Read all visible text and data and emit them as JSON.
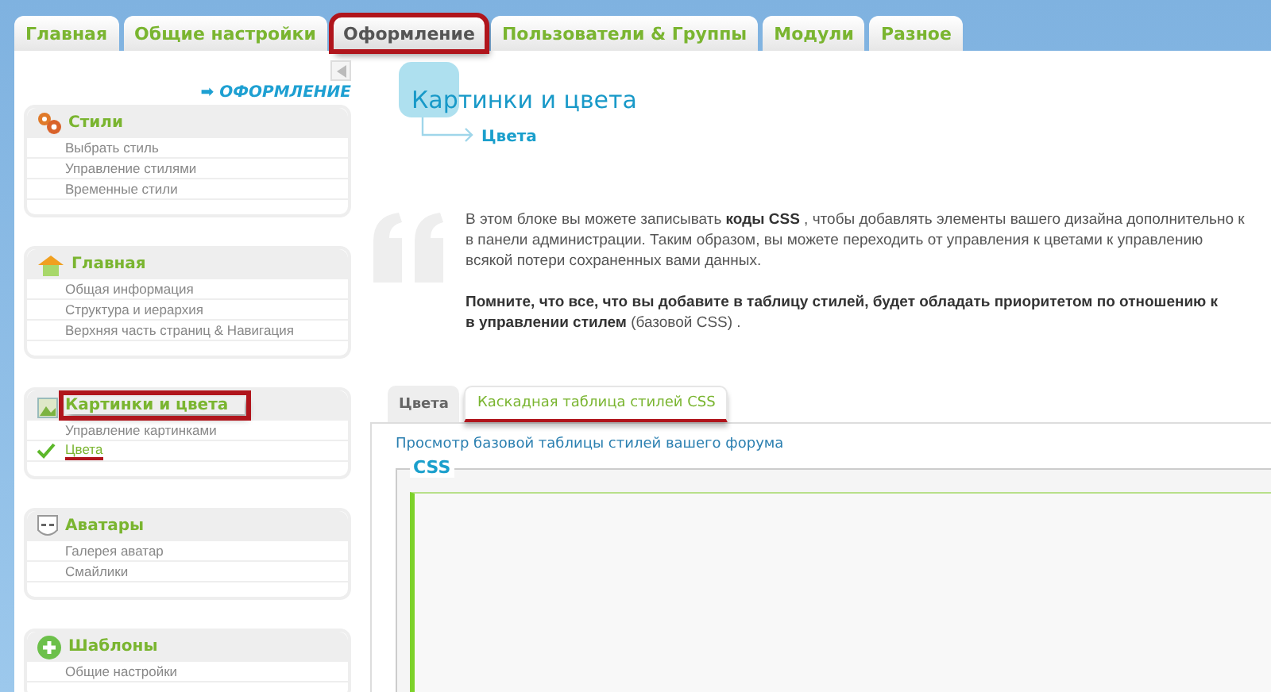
{
  "tabs": [
    {
      "label": "Главная",
      "selected": false,
      "highlighted": false
    },
    {
      "label": "Общие настройки",
      "selected": false,
      "highlighted": false
    },
    {
      "label": "Оформление",
      "selected": true,
      "highlighted": true
    },
    {
      "label": "Пользователи & Группы",
      "selected": false,
      "highlighted": false
    },
    {
      "label": "Модули",
      "selected": false,
      "highlighted": false
    },
    {
      "label": "Разное",
      "selected": false,
      "highlighted": false
    }
  ],
  "sidebar": {
    "section_title": "➡ ОФОРМЛЕНИЕ",
    "groups": [
      {
        "kind": "palette",
        "title": "Стили",
        "highlighted": false,
        "items": [
          {
            "label": "Выбрать стиль",
            "selected": false,
            "highlighted": false
          },
          {
            "label": "Управление стилями",
            "selected": false,
            "highlighted": false
          },
          {
            "label": "Временные стили",
            "selected": false,
            "highlighted": false
          }
        ]
      },
      {
        "kind": "house",
        "title": "Главная",
        "highlighted": false,
        "items": [
          {
            "label": "Общая информация",
            "selected": false,
            "highlighted": false
          },
          {
            "label": "Структура и иерархия",
            "selected": false,
            "highlighted": false
          },
          {
            "label": "Верхняя часть страниц & Навигация",
            "selected": false,
            "highlighted": false
          }
        ]
      },
      {
        "kind": "picture",
        "title": "Картинки и цвета",
        "highlighted": true,
        "items": [
          {
            "label": "Управление картинками",
            "selected": false,
            "highlighted": false
          },
          {
            "label": "Цвета",
            "selected": true,
            "highlighted": true
          }
        ]
      },
      {
        "kind": "mask",
        "title": "Аватары",
        "highlighted": false,
        "items": [
          {
            "label": "Галерея аватар",
            "selected": false,
            "highlighted": false
          },
          {
            "label": "Смайлики",
            "selected": false,
            "highlighted": false
          }
        ]
      },
      {
        "kind": "plus",
        "title": "Шаблоны",
        "highlighted": false,
        "items": [
          {
            "label": "Общие настройки",
            "selected": false,
            "highlighted": false
          }
        ]
      }
    ]
  },
  "page": {
    "title": "Картинки и цвета",
    "breadcrumb": "Цвета",
    "intro_lines": [
      "В этом блоке вы можете записывать **коды CSS** , чтобы добавлять элементы вашего дизайна дополнительно к",
      "в панели администрации. Таким образом, вы можете переходить от управления к цветами к управлению",
      "всякой потери сохраненных вами данных."
    ],
    "note_lines": [
      "**Помните, что все, что вы добавите в таблицу стилей, будет обладать приоритетом по отношению к**",
      "**в управлении стилем** (базовой CSS) ."
    ],
    "subtabs": [
      {
        "label": "Цвета",
        "selected": false,
        "highlighted": false
      },
      {
        "label": "Каскадная таблица стилей CSS",
        "selected": true,
        "highlighted": true
      }
    ],
    "view_link": "Просмотр базовой таблицы стилей вашего форума",
    "fieldset_legend": "CSS"
  }
}
